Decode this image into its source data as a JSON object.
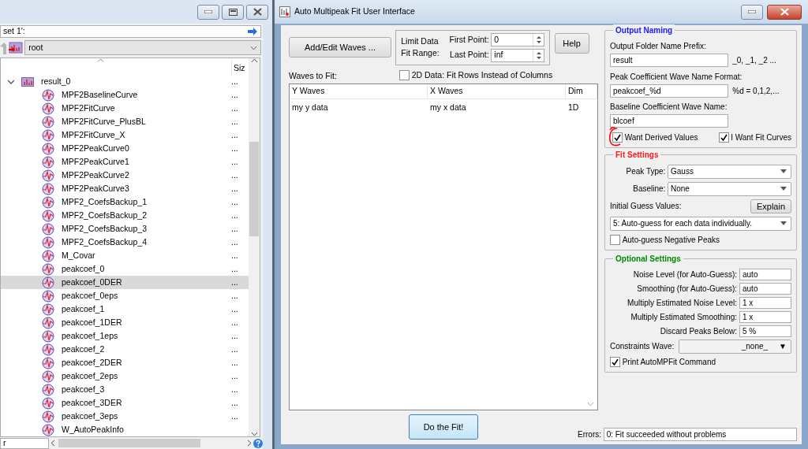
{
  "browser": {
    "path_field": "set 1':",
    "folder_select": "root",
    "size_header": "Siz",
    "tree": [
      {
        "label": "result_0",
        "kind": "folder",
        "expanded": true,
        "selected": false,
        "size": "...",
        "children": [
          {
            "label": "MPF2BaselineCurve",
            "kind": "wave",
            "selected": false,
            "size": "..."
          },
          {
            "label": "MPF2FitCurve",
            "kind": "wave",
            "selected": false,
            "size": "..."
          },
          {
            "label": "MPF2FitCurve_PlusBL",
            "kind": "wave",
            "selected": false,
            "size": "..."
          },
          {
            "label": "MPF2FitCurve_X",
            "kind": "wave",
            "selected": false,
            "size": "..."
          },
          {
            "label": "MPF2PeakCurve0",
            "kind": "wave",
            "selected": false,
            "size": "..."
          },
          {
            "label": "MPF2PeakCurve1",
            "kind": "wave",
            "selected": false,
            "size": "..."
          },
          {
            "label": "MPF2PeakCurve2",
            "kind": "wave",
            "selected": false,
            "size": "..."
          },
          {
            "label": "MPF2PeakCurve3",
            "kind": "wave",
            "selected": false,
            "size": "..."
          },
          {
            "label": "MPF2_CoefsBackup_1",
            "kind": "wave",
            "selected": false,
            "size": "..."
          },
          {
            "label": "MPF2_CoefsBackup_2",
            "kind": "wave",
            "selected": false,
            "size": "..."
          },
          {
            "label": "MPF2_CoefsBackup_3",
            "kind": "wave",
            "selected": false,
            "size": "..."
          },
          {
            "label": "MPF2_CoefsBackup_4",
            "kind": "wave",
            "selected": false,
            "size": "..."
          },
          {
            "label": "M_Covar",
            "kind": "wave",
            "selected": false,
            "size": "..."
          },
          {
            "label": "peakcoef_0",
            "kind": "wave",
            "selected": false,
            "size": "..."
          },
          {
            "label": "peakcoef_0DER",
            "kind": "wave",
            "selected": true,
            "size": "..."
          },
          {
            "label": "peakcoef_0eps",
            "kind": "wave",
            "selected": false,
            "size": "..."
          },
          {
            "label": "peakcoef_1",
            "kind": "wave",
            "selected": false,
            "size": "..."
          },
          {
            "label": "peakcoef_1DER",
            "kind": "wave",
            "selected": false,
            "size": "..."
          },
          {
            "label": "peakcoef_1eps",
            "kind": "wave",
            "selected": false,
            "size": "..."
          },
          {
            "label": "peakcoef_2",
            "kind": "wave",
            "selected": false,
            "size": "..."
          },
          {
            "label": "peakcoef_2DER",
            "kind": "wave",
            "selected": false,
            "size": "..."
          },
          {
            "label": "peakcoef_2eps",
            "kind": "wave",
            "selected": false,
            "size": "..."
          },
          {
            "label": "peakcoef_3",
            "kind": "wave",
            "selected": false,
            "size": "..."
          },
          {
            "label": "peakcoef_3DER",
            "kind": "wave",
            "selected": false,
            "size": "..."
          },
          {
            "label": "peakcoef_3eps",
            "kind": "wave",
            "selected": false,
            "size": "..."
          },
          {
            "label": "W_AutoPeakInfo",
            "kind": "wave",
            "selected": false
          }
        ]
      }
    ],
    "filter_field": "r"
  },
  "dialog": {
    "title": "Auto Multipeak Fit User Interface",
    "add_edit_button": "Add/Edit Waves ...",
    "range": {
      "label": "Limit Data Fit Range:",
      "first_label": "First Point:",
      "first_value": "0",
      "last_label": "Last Point:",
      "last_value": "inf"
    },
    "help_button": "Help",
    "rows_checkbox": {
      "label": "2D Data: Fit Rows Instead of Columns",
      "checked": false
    },
    "waves_label": "Waves to Fit:",
    "table": {
      "columns": [
        "Y Waves",
        "X Waves",
        "Dim"
      ],
      "rows": [
        [
          "my y data",
          "my x data",
          "1D"
        ]
      ]
    },
    "fit_button": "Do the Fit!",
    "errors": {
      "label": "Errors:",
      "value": "0: Fit succeeded without problems"
    },
    "output_naming": {
      "title": "Output Naming",
      "fields": [
        {
          "label": "Output Folder Name Prefix:",
          "value": "result",
          "suffix": "_0, _1, _2 ..."
        },
        {
          "label": "Peak Coefficient Wave Name Format:",
          "value": "peakcoef_%d",
          "suffix": "%d = 0,1,2,..."
        },
        {
          "label": "Baseline Coefficient Wave Name:",
          "value": "blcoef"
        }
      ],
      "checkboxes": [
        {
          "label": "Want Derived Values",
          "checked": true,
          "annotated": true
        },
        {
          "label": "I Want Fit Curves",
          "checked": true,
          "annotated": false
        }
      ]
    },
    "fit_settings": {
      "title": "Fit Settings",
      "peak_type": {
        "label": "Peak Type:",
        "value": "Gauss"
      },
      "baseline": {
        "label": "Baseline:",
        "value": "None"
      },
      "guess_label": "Initial Guess Values:",
      "explain_button": "Explain",
      "guess_select": "5: Auto-guess for each data individually.",
      "negative_checkbox": {
        "label": "Auto-guess Negative Peaks",
        "checked": false
      }
    },
    "optional_settings": {
      "title": "Optional Settings",
      "fields": [
        {
          "label": "Noise Level (for Auto-Guess):",
          "value": "auto"
        },
        {
          "label": "Smoothing (for Auto-Guess):",
          "value": "auto"
        },
        {
          "label": "Multiply Estimated Noise Level:",
          "value": "1 x"
        },
        {
          "label": "Multiply Estimated Smoothing:",
          "value": "1 x"
        },
        {
          "label": "Discard Peaks Below:",
          "value": "5 %"
        }
      ],
      "constraints": {
        "label": "Constraints Wave:",
        "value": "_none_",
        "arrow": "▼"
      },
      "print_checkbox": {
        "label": "Print AutoMPFit Command",
        "checked": true
      }
    }
  }
}
